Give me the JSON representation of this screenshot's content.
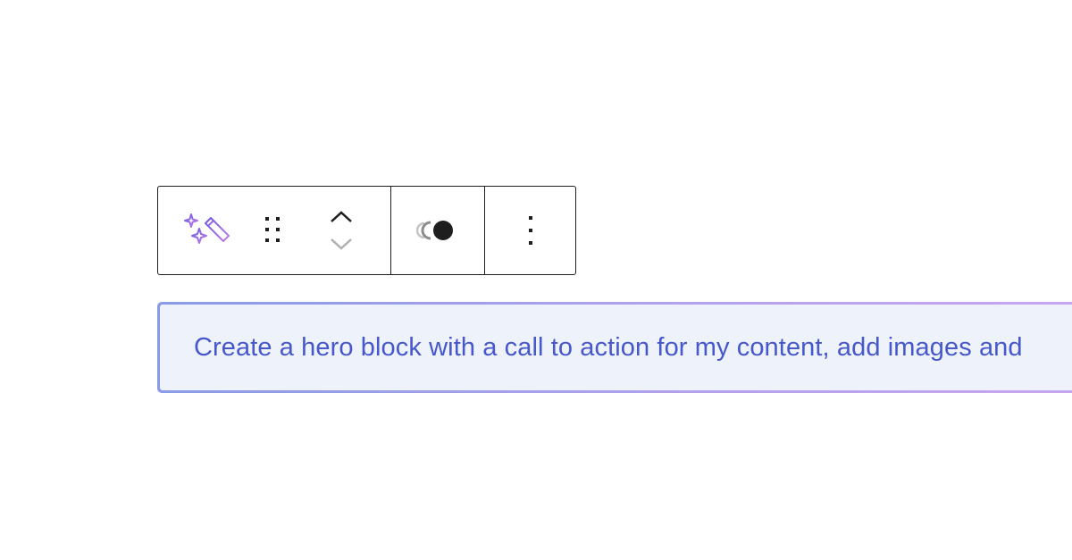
{
  "toolbar": {
    "icons": {
      "ai": "magic-wand-sparkles-icon",
      "drag": "drag-handle-icon",
      "move_up": "chevron-up-icon",
      "move_down": "chevron-down-icon",
      "style": "block-style-icon",
      "more": "more-vertical-icon"
    }
  },
  "prompt": {
    "text": "Create a hero block with a call to action for my content, add images and"
  },
  "colors": {
    "prompt_text": "#4658cc",
    "prompt_bg": "#eef2fb",
    "gradient_start": "#8a9be6",
    "gradient_end": "#c9a6f0",
    "ai_icon": "#9b6ae8"
  }
}
